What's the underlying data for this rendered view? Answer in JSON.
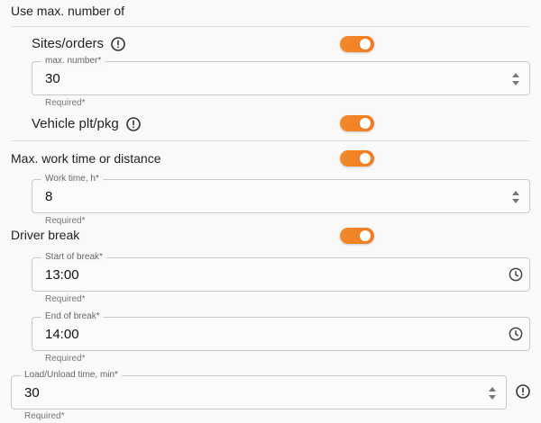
{
  "header": {
    "title": "Use max. number of"
  },
  "sites": {
    "label": "Sites/orders",
    "field": {
      "label": "max. number*",
      "value": "30",
      "helper": "Required*"
    }
  },
  "vehicle": {
    "label": "Vehicle plt/pkg"
  },
  "work": {
    "label": "Max. work time or distance",
    "field": {
      "label": "Work time, h*",
      "value": "8",
      "helper": "Required*"
    }
  },
  "driver_break": {
    "label": "Driver break",
    "start": {
      "label": "Start of break*",
      "value": "13:00",
      "helper": "Required*"
    },
    "end": {
      "label": "End of break*",
      "value": "14:00",
      "helper": "Required*"
    }
  },
  "load": {
    "label": "Load/Unload time, min*",
    "value": "30",
    "helper": "Required*"
  },
  "colors": {
    "accent": "#f47a20",
    "border": "#c9c9c9"
  },
  "icons": [
    "info-icon",
    "stepper-icon",
    "clock-icon"
  ]
}
